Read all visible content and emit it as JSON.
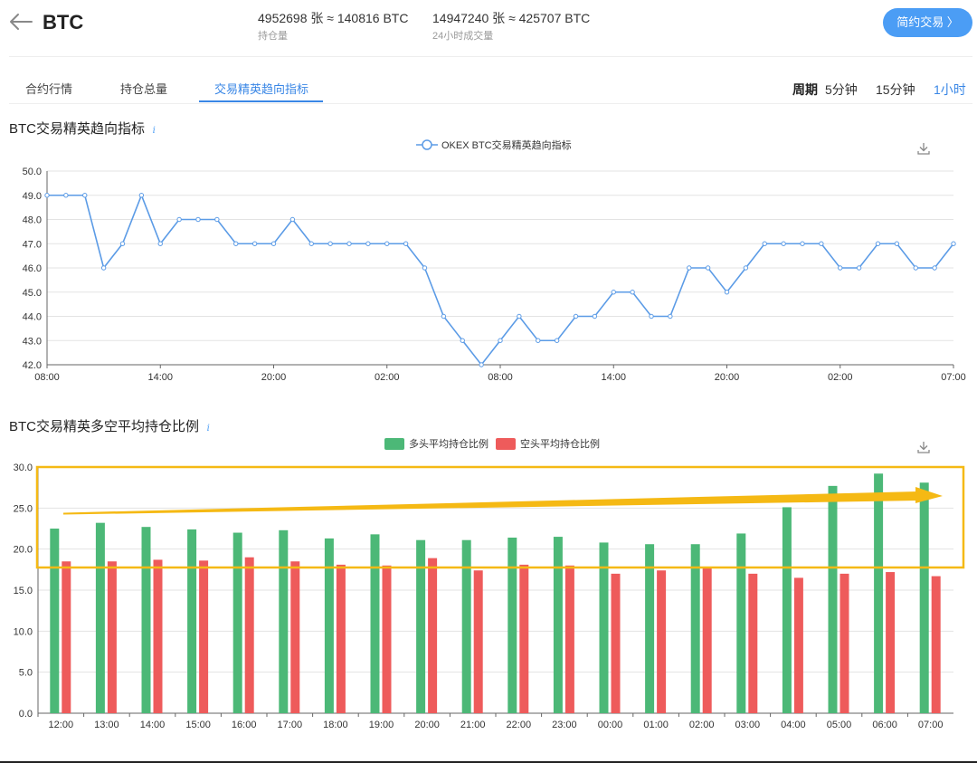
{
  "header": {
    "coin": "BTC",
    "open_interest": "4952698 张 ≈ 140816 BTC",
    "open_interest_label": "持仓量",
    "volume_24h": "14947240 张 ≈ 425707 BTC",
    "volume_24h_label": "24小时成交量",
    "trade_button": "简约交易 〉"
  },
  "tabs": [
    {
      "label": "合约行情",
      "active": false
    },
    {
      "label": "持仓总量",
      "active": false
    },
    {
      "label": "交易精英趋向指标",
      "active": true
    }
  ],
  "period": {
    "label": "周期",
    "options": [
      {
        "label": "5分钟",
        "active": false
      },
      {
        "label": "15分钟",
        "active": false
      },
      {
        "label": "1小时",
        "active": true
      }
    ]
  },
  "icons": [
    "back-arrow-icon",
    "info-icon",
    "download-icon"
  ],
  "colors": {
    "accent": "#3a87e6",
    "line": "#5b9be6",
    "long": "#4cb877",
    "short": "#ee5b5b",
    "annotation": "#f5b914"
  },
  "chart_data": [
    {
      "type": "line",
      "title": "BTC交易精英趋向指标",
      "legend": [
        "OKEX BTC交易精英趋向指标"
      ],
      "legend_position": "top-center",
      "grid": true,
      "ylim": [
        42.0,
        50.0
      ],
      "yticks": [
        "42.0",
        "43.0",
        "44.0",
        "45.0",
        "46.0",
        "47.0",
        "48.0",
        "49.0",
        "50.0"
      ],
      "xticks": [
        "08:00",
        "14:00",
        "20:00",
        "02:00",
        "08:00",
        "14:00",
        "20:00",
        "02:00",
        "07:00"
      ],
      "series": [
        {
          "name": "OKEX BTC交易精英趋向指标",
          "values": [
            49,
            49,
            49,
            46,
            47,
            49,
            47,
            48,
            48,
            48,
            47,
            47,
            47,
            48,
            47,
            47,
            47,
            47,
            47,
            47,
            46,
            44,
            43,
            42,
            43,
            44,
            43,
            43,
            44,
            44,
            45,
            45,
            44,
            44,
            46,
            46,
            45,
            46,
            47,
            47,
            47,
            47,
            46,
            46,
            47,
            47,
            46,
            46,
            47
          ]
        }
      ]
    },
    {
      "type": "bar",
      "title": "BTC交易精英多空平均持仓比例",
      "legend_position": "top-center",
      "grid": true,
      "ylim": [
        0.0,
        30.0
      ],
      "yticks": [
        "0.0",
        "5.0",
        "10.0",
        "15.0",
        "20.0",
        "25.0",
        "30.0"
      ],
      "categories": [
        "12:00",
        "13:00",
        "14:00",
        "15:00",
        "16:00",
        "17:00",
        "18:00",
        "19:00",
        "20:00",
        "21:00",
        "22:00",
        "23:00",
        "00:00",
        "01:00",
        "02:00",
        "03:00",
        "04:00",
        "05:00",
        "06:00",
        "07:00"
      ],
      "series": [
        {
          "name": "多头平均持仓比例",
          "values": [
            22.5,
            23.2,
            22.7,
            22.4,
            22.0,
            22.3,
            21.3,
            21.8,
            21.1,
            21.1,
            21.4,
            21.5,
            20.8,
            20.6,
            20.6,
            21.9,
            25.1,
            27.7,
            29.2,
            28.1
          ]
        },
        {
          "name": "空头平均持仓比例",
          "values": [
            18.5,
            18.5,
            18.7,
            18.6,
            19.0,
            18.5,
            18.1,
            18.0,
            18.9,
            17.4,
            18.1,
            18.0,
            17.0,
            17.4,
            17.7,
            17.0,
            16.5,
            17.0,
            17.2,
            16.7
          ]
        }
      ]
    }
  ]
}
